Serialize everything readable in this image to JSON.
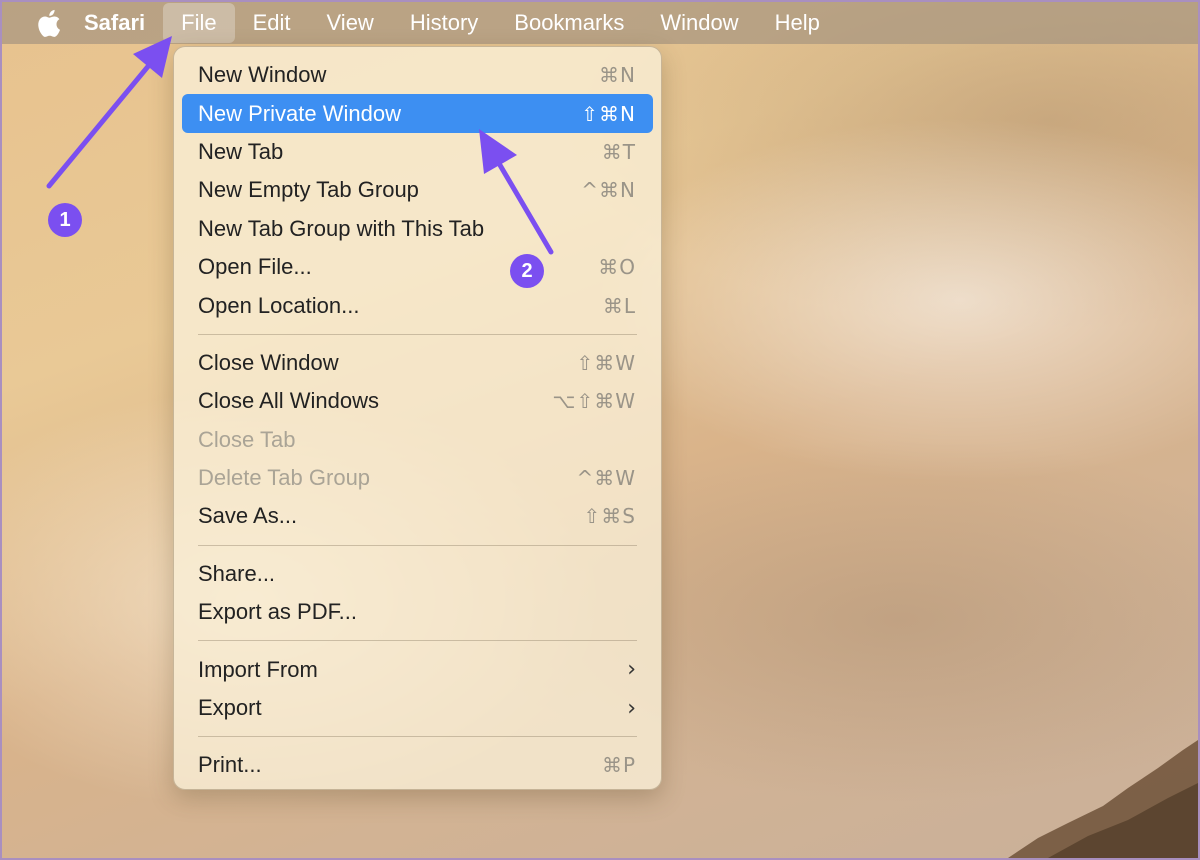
{
  "menubar": {
    "apple_icon": "apple-logo-icon",
    "app_name": "Safari",
    "items": [
      "File",
      "Edit",
      "View",
      "History",
      "Bookmarks",
      "Window",
      "Help"
    ],
    "active_item": "File"
  },
  "file_menu": {
    "groups": [
      [
        {
          "label": "New Window",
          "shortcut": "⌘N"
        },
        {
          "label": "New Private Window",
          "shortcut": "⇧⌘N",
          "highlighted": true
        },
        {
          "label": "New Tab",
          "shortcut": "⌘T"
        },
        {
          "label": "New Empty Tab Group",
          "shortcut": "^⌘N"
        },
        {
          "label": "New Tab Group with This Tab",
          "shortcut": ""
        },
        {
          "label": "Open File...",
          "shortcut": "⌘O"
        },
        {
          "label": "Open Location...",
          "shortcut": "⌘L"
        }
      ],
      [
        {
          "label": "Close Window",
          "shortcut": "⇧⌘W"
        },
        {
          "label": "Close All Windows",
          "shortcut": "⌥⇧⌘W"
        },
        {
          "label": "Close Tab",
          "shortcut": "",
          "disabled": true
        },
        {
          "label": "Delete Tab Group",
          "shortcut": "^⌘W",
          "disabled": true
        },
        {
          "label": "Save As...",
          "shortcut": "⇧⌘S"
        }
      ],
      [
        {
          "label": "Share...",
          "shortcut": ""
        },
        {
          "label": "Export as PDF...",
          "shortcut": ""
        }
      ],
      [
        {
          "label": "Import From",
          "shortcut": "",
          "submenu": true
        },
        {
          "label": "Export",
          "shortcut": "",
          "submenu": true
        }
      ],
      [
        {
          "label": "Print...",
          "shortcut": "⌘P"
        }
      ]
    ]
  },
  "annotations": {
    "step1": "1",
    "step2": "2",
    "accent_color": "#7b4ff0"
  },
  "colors": {
    "highlight": "#3d8ff2",
    "menubar_text": "#ffffff",
    "disabled_text": "#aaa496"
  }
}
